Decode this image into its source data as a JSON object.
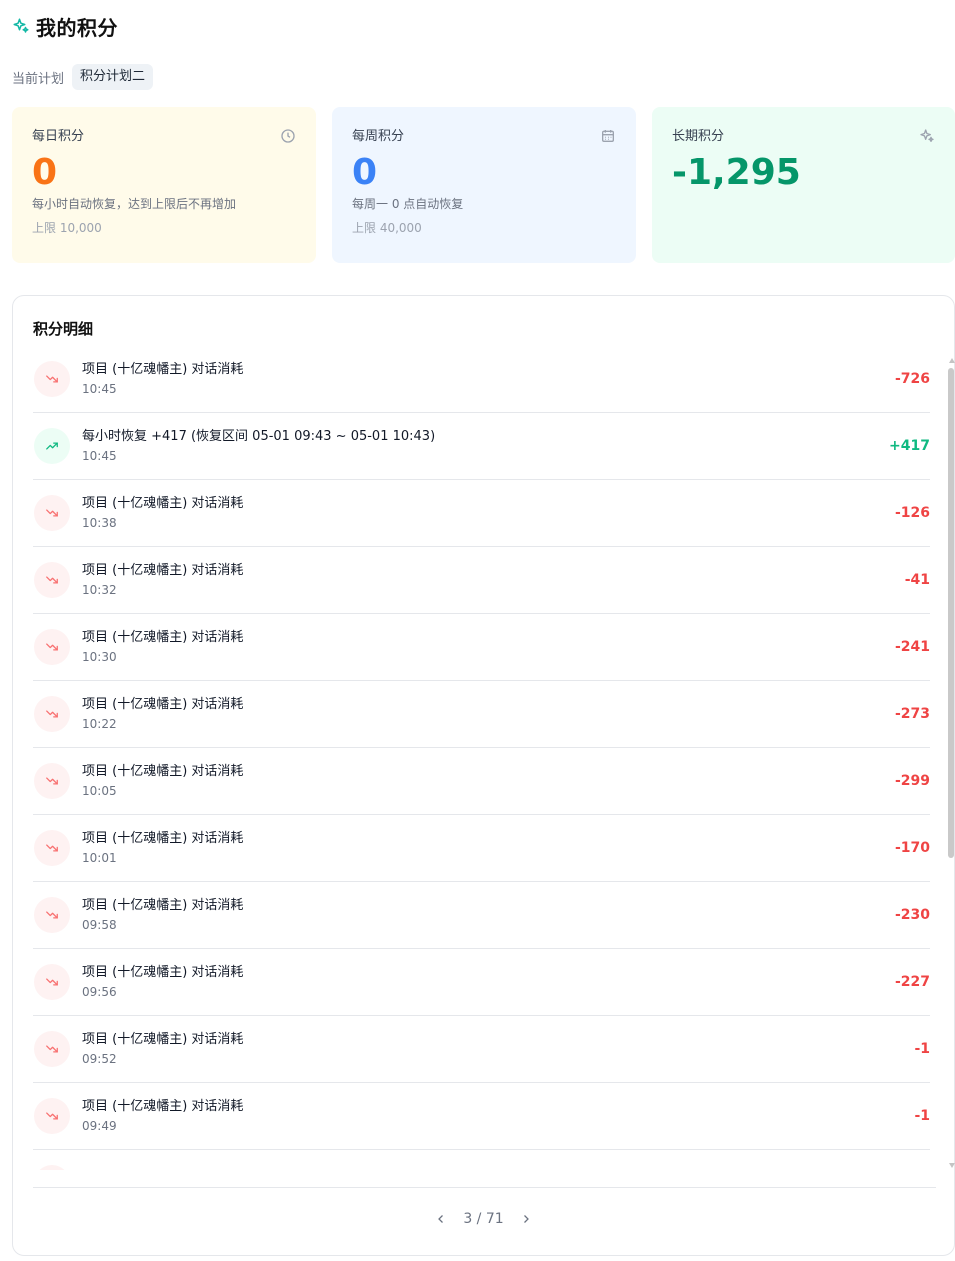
{
  "header": {
    "title": "我的积分",
    "icon": "sparkles-icon",
    "accent": "#14b8a6"
  },
  "plan": {
    "label": "当前计划",
    "current": "积分计划二"
  },
  "cards": {
    "daily": {
      "label": "每日积分",
      "icon": "clock-icon",
      "value": "0",
      "desc": "每小时自动恢复，达到上限后不再增加",
      "limit": "上限 10,000"
    },
    "weekly": {
      "label": "每周积分",
      "icon": "calendar-icon",
      "value": "0",
      "desc": "每周一 0 点自动恢复",
      "limit": "上限 40,000"
    },
    "longterm": {
      "label": "长期积分",
      "icon": "sparkles-icon",
      "value": "-1,295"
    }
  },
  "details": {
    "title": "积分明细",
    "rows": [
      {
        "title": "项目 (十亿魂幡主) 对话消耗",
        "time": "10:45",
        "amount": "-726",
        "type": "neg"
      },
      {
        "title": "每小时恢复 +417 (恢复区间 05-01 09:43 ~ 05-01 10:43)",
        "time": "10:45",
        "amount": "+417",
        "type": "pos"
      },
      {
        "title": "项目 (十亿魂幡主) 对话消耗",
        "time": "10:38",
        "amount": "-126",
        "type": "neg"
      },
      {
        "title": "项目 (十亿魂幡主) 对话消耗",
        "time": "10:32",
        "amount": "-41",
        "type": "neg"
      },
      {
        "title": "项目 (十亿魂幡主) 对话消耗",
        "time": "10:30",
        "amount": "-241",
        "type": "neg"
      },
      {
        "title": "项目 (十亿魂幡主) 对话消耗",
        "time": "10:22",
        "amount": "-273",
        "type": "neg"
      },
      {
        "title": "项目 (十亿魂幡主) 对话消耗",
        "time": "10:05",
        "amount": "-299",
        "type": "neg"
      },
      {
        "title": "项目 (十亿魂幡主) 对话消耗",
        "time": "10:01",
        "amount": "-170",
        "type": "neg"
      },
      {
        "title": "项目 (十亿魂幡主) 对话消耗",
        "time": "09:58",
        "amount": "-230",
        "type": "neg"
      },
      {
        "title": "项目 (十亿魂幡主) 对话消耗",
        "time": "09:56",
        "amount": "-227",
        "type": "neg"
      },
      {
        "title": "项目 (十亿魂幡主) 对话消耗",
        "time": "09:52",
        "amount": "-1",
        "type": "neg"
      },
      {
        "title": "项目 (十亿魂幡主) 对话消耗",
        "time": "09:49",
        "amount": "-1",
        "type": "neg"
      },
      {
        "title": "项目 (十亿魂幡主) 对话消耗",
        "time": "",
        "amount": "",
        "type": "neg"
      }
    ]
  },
  "pagination": {
    "current": 3,
    "total": 71,
    "text": "3 / 71"
  },
  "colors": {
    "negative": "#ef4444",
    "positive": "#10b981"
  }
}
